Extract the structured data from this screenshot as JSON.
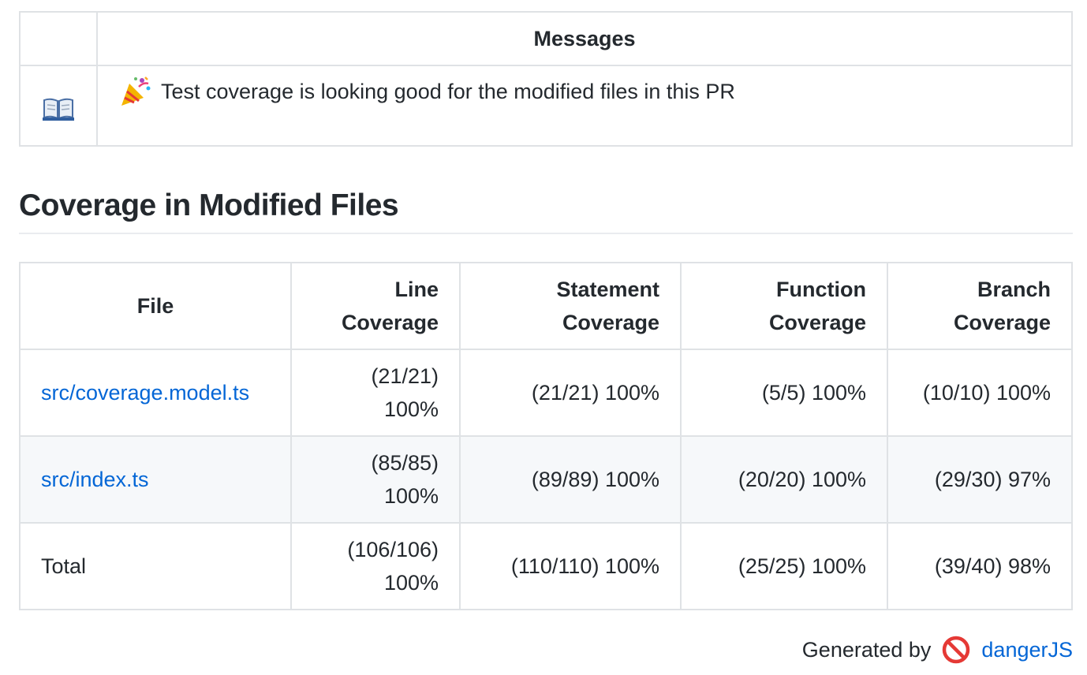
{
  "messages": {
    "header": "Messages",
    "rows": [
      {
        "icon": "book-icon",
        "emoji": "party-popper-icon",
        "text": "Test coverage is looking good for the modified files in this PR"
      }
    ]
  },
  "coverage": {
    "title": "Coverage in Modified Files",
    "headers": {
      "file": "File",
      "line_1": "Line",
      "line_2": "Coverage",
      "statement_1": "Statement",
      "statement_2": "Coverage",
      "function_1": "Function",
      "function_2": "Coverage",
      "branch_1": "Branch",
      "branch_2": "Coverage"
    },
    "rows": [
      {
        "file": "src/coverage.model.ts",
        "line_1": "(21/21)",
        "line_2": "100%",
        "statement": "(21/21) 100%",
        "function": "(5/5) 100%",
        "branch": "(10/10) 100%"
      },
      {
        "file": "src/index.ts",
        "line_1": "(85/85)",
        "line_2": "100%",
        "statement": "(89/89) 100%",
        "function": "(20/20) 100%",
        "branch": "(29/30) 97%"
      },
      {
        "file": "Total",
        "line_1": "(106/106)",
        "line_2": "100%",
        "statement": "(110/110) 100%",
        "function": "(25/25) 100%",
        "branch": "(39/40) 98%"
      }
    ]
  },
  "footer": {
    "generated_by": "Generated by",
    "icon": "no-entry-icon",
    "link": "dangerJS"
  },
  "colors": {
    "link": "#0366d6",
    "border": "#dfe2e5",
    "alt_row": "#f6f8fa",
    "text": "#24292e"
  }
}
